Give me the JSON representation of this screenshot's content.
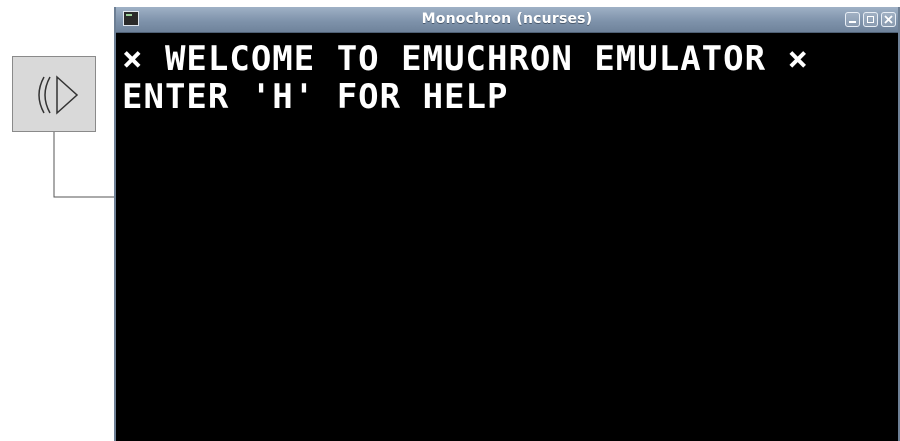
{
  "window": {
    "title": "Monochron (ncurses)"
  },
  "terminal": {
    "line1": "× WELCOME TO EMUCHRON EMULATOR ×",
    "line2": "ENTER 'H' FOR HELP"
  },
  "icons": {
    "speaker": "speaker-icon",
    "app": "terminal-app-icon",
    "minimize": "minimize-icon",
    "maximize": "maximize-icon",
    "close": "close-icon"
  },
  "colors": {
    "titlebar": "#7f93ab",
    "screen_bg": "#000000",
    "screen_fg": "#ffffff",
    "speaker_bg": "#d9d9d9"
  }
}
